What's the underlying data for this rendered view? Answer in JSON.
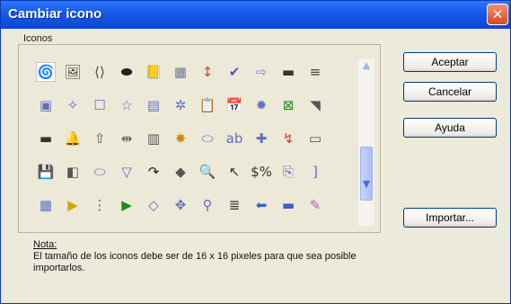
{
  "window": {
    "title": "Cambiar icono",
    "close_symbol": "✕"
  },
  "group": {
    "label": "Iconos"
  },
  "buttons": {
    "accept": "Aceptar",
    "cancel": "Cancelar",
    "help": "Ayuda",
    "import": "Importar..."
  },
  "note": {
    "title": "Nota:",
    "text": "El tamaño de los iconos debe ser de 16 x 16 pixeles para que sea posible importarlos."
  },
  "icons": [
    {
      "glyph": "🌀",
      "name": "swirl-icon",
      "color": "#5b6fd4"
    },
    {
      "glyph": "🖼",
      "name": "image-icon",
      "color": "#4a4a4a"
    },
    {
      "glyph": "⟨⟩",
      "name": "code-brackets-icon",
      "color": "#444"
    },
    {
      "glyph": "⬬",
      "name": "ellipse-icon",
      "color": "#222"
    },
    {
      "glyph": "📒",
      "name": "notebook-icon",
      "color": "#d8a600"
    },
    {
      "glyph": "▦",
      "name": "grid-icon",
      "color": "#6c7a9e"
    },
    {
      "glyph": "↕",
      "name": "sort-icon",
      "color": "#c43"
    },
    {
      "glyph": "✔",
      "name": "spellcheck-icon",
      "color": "#5c4dbf"
    },
    {
      "glyph": "⇨",
      "name": "arrow-right-icon",
      "color": "#7b87cf"
    },
    {
      "glyph": "▬",
      "name": "bar-icon",
      "color": "#333"
    },
    {
      "glyph": "≡",
      "name": "lines-icon",
      "color": "#444"
    },
    {
      "glyph": "▣",
      "name": "frame-icon",
      "color": "#5f6fc0"
    },
    {
      "glyph": "✧",
      "name": "diamond-star-icon",
      "color": "#6370c6"
    },
    {
      "glyph": "☐",
      "name": "square-icon",
      "color": "#6370c6"
    },
    {
      "glyph": "☆",
      "name": "star-icon",
      "color": "#6370c6"
    },
    {
      "glyph": "▤",
      "name": "table-icon",
      "color": "#6370c6"
    },
    {
      "glyph": "✲",
      "name": "burst-icon",
      "color": "#6370c6"
    },
    {
      "glyph": "📋",
      "name": "form-icon",
      "color": "#6370c6"
    },
    {
      "glyph": "📅",
      "name": "calendar-icon",
      "color": "#6370c6"
    },
    {
      "glyph": "✹",
      "name": "sun-icon",
      "color": "#6370c6"
    },
    {
      "glyph": "⊠",
      "name": "cross-box-icon",
      "color": "#1a8d1a"
    },
    {
      "glyph": "◥",
      "name": "ramp-icon",
      "color": "#555"
    },
    {
      "glyph": "▬",
      "name": "dark-bar-icon",
      "color": "#333"
    },
    {
      "glyph": "🔔",
      "name": "bell-icon",
      "color": "#c98b1a"
    },
    {
      "glyph": "⇧",
      "name": "arrow-up-icon",
      "color": "#555"
    },
    {
      "glyph": "⇹",
      "name": "distribute-icon",
      "color": "#555"
    },
    {
      "glyph": "▥",
      "name": "columns-icon",
      "color": "#555"
    },
    {
      "glyph": "✸",
      "name": "sparkle-icon",
      "color": "#c98b1a"
    },
    {
      "glyph": "⬭",
      "name": "rounded-rect-icon",
      "color": "#5f6fc0"
    },
    {
      "glyph": "ab",
      "name": "text-box-icon",
      "color": "#5f6fc0"
    },
    {
      "glyph": "✚",
      "name": "plus-shape-icon",
      "color": "#5f6fc0"
    },
    {
      "glyph": "↯",
      "name": "zigzag-icon",
      "color": "#c43"
    },
    {
      "glyph": "▭",
      "name": "wide-bar-icon",
      "color": "#555"
    },
    {
      "glyph": "💾",
      "name": "save-icon",
      "color": "#2a4ea8"
    },
    {
      "glyph": "◧",
      "name": "split-panel-icon",
      "color": "#555"
    },
    {
      "glyph": "⬭",
      "name": "capsule-icon",
      "color": "#5f6fc0"
    },
    {
      "glyph": "▽",
      "name": "triangle-down-icon",
      "color": "#5f6fc0"
    },
    {
      "glyph": "↷",
      "name": "curved-arrow-icon",
      "color": "#222"
    },
    {
      "glyph": "◆",
      "name": "banner-icon",
      "color": "#555"
    },
    {
      "glyph": "🔍",
      "name": "zoom-icon",
      "color": "#5f6fc0"
    },
    {
      "glyph": "↖",
      "name": "pointer-icon",
      "color": "#333"
    },
    {
      "glyph": "$%",
      "name": "symbols-icon",
      "color": "#333"
    },
    {
      "glyph": "⎘",
      "name": "paste-icon",
      "color": "#5f6fc0"
    },
    {
      "glyph": "]",
      "name": "bracket-icon",
      "color": "#5f6fc0"
    },
    {
      "glyph": "▦",
      "name": "table-grid-icon",
      "color": "#5f6fc0"
    },
    {
      "glyph": "▶",
      "name": "play-icon",
      "color": "#d1a600"
    },
    {
      "glyph": "⋮",
      "name": "spin-icon",
      "color": "#555"
    },
    {
      "glyph": "▶",
      "name": "media-icon",
      "color": "#1a8d1a"
    },
    {
      "glyph": "◇",
      "name": "diamond-icon",
      "color": "#5f6fc0"
    },
    {
      "glyph": "✥",
      "name": "navigator-icon",
      "color": "#5f6fc0"
    },
    {
      "glyph": "⚲",
      "name": "pin-icon",
      "color": "#5f6fc0"
    },
    {
      "glyph": "≣",
      "name": "list-icon",
      "color": "#333"
    },
    {
      "glyph": "⬅",
      "name": "back-arrow-icon",
      "color": "#3b61c7"
    },
    {
      "glyph": "▬",
      "name": "strip-icon",
      "color": "#3b61c7"
    },
    {
      "glyph": "✎",
      "name": "wand-icon",
      "color": "#b05fc0"
    }
  ]
}
